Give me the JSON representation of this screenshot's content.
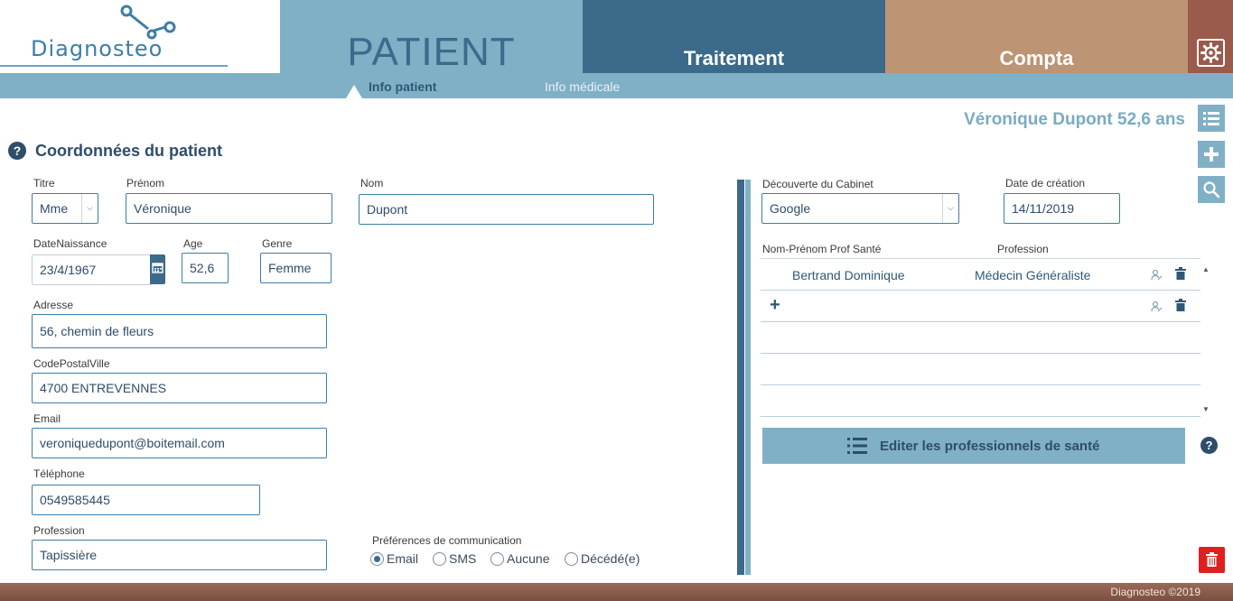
{
  "app": {
    "logo_text": "Diagnosteo"
  },
  "header": {
    "tabs": [
      {
        "label": "PATIENT",
        "active": true,
        "color": "#80b0c5"
      },
      {
        "label": "Traitement",
        "active": false,
        "color": "#3b6a8a"
      },
      {
        "label": "Compta",
        "active": false,
        "color": "#bd9474"
      }
    ],
    "settings_icon": "gear-icon"
  },
  "subnav": {
    "items": [
      {
        "label": "Info patient",
        "active": true
      },
      {
        "label": "Info médicale",
        "active": false
      }
    ]
  },
  "patient_name": "Véronique Dupont 52,6 ans",
  "side_buttons": [
    "list-icon",
    "plus-icon",
    "search-icon"
  ],
  "section": {
    "title": "Coordonnées du patient"
  },
  "form": {
    "titre": {
      "label": "Titre",
      "value": "Mme"
    },
    "prenom": {
      "label": "Prénom",
      "value": "Véronique"
    },
    "nom": {
      "label": "Nom",
      "value": "Dupont"
    },
    "date_naissance": {
      "label": "DateNaissance",
      "value": "23/4/1967"
    },
    "age": {
      "label": "Age",
      "value": "52,6"
    },
    "genre": {
      "label": "Genre",
      "value": "Femme"
    },
    "adresse": {
      "label": "Adresse",
      "value": "56, chemin de fleurs"
    },
    "cp_ville": {
      "label": "CodePostalVille",
      "value": "4700 ENTREVENNES"
    },
    "email": {
      "label": "Email",
      "value": "veroniquedupont@boitemail.com"
    },
    "telephone": {
      "label": "Téléphone",
      "value": "0549585445"
    },
    "profession": {
      "label": "Profession",
      "value": "Tapissière"
    }
  },
  "communication": {
    "label": "Préférences de communication",
    "options": [
      {
        "label": "Email",
        "selected": true
      },
      {
        "label": "SMS",
        "selected": false
      },
      {
        "label": "Aucune",
        "selected": false
      },
      {
        "label": "Décédé(e)",
        "selected": false
      }
    ]
  },
  "right_panel": {
    "decouverte": {
      "label": "Découverte du Cabinet",
      "value": "Google"
    },
    "date_creation": {
      "label": "Date de création",
      "value": "14/11/2019"
    },
    "table": {
      "headers": [
        "Nom-Prénom Prof Santé",
        "Profession"
      ],
      "rows": [
        {
          "name": "Bertrand Dominique",
          "profession": "Médecin Généraliste"
        }
      ]
    },
    "edit_button": "Editer les professionnels de santé"
  },
  "footer": {
    "text": "Diagnosteo ©2019"
  },
  "colors": {
    "accent_light": "#80b0c5",
    "accent_dark": "#3b6a8a",
    "compta": "#bd9474",
    "settings": "#9a5a4c",
    "danger": "#e02020"
  }
}
